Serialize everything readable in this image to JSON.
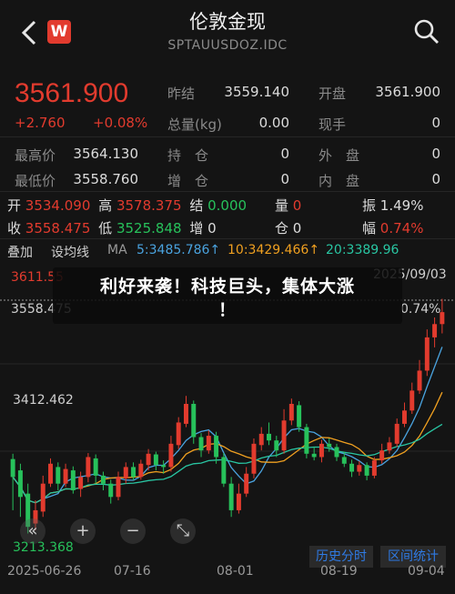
{
  "header": {
    "title": "伦敦金现",
    "code": "SPTAUUSDOZ.IDC",
    "badge": "W"
  },
  "quote": {
    "price": "3561.900",
    "change": "+2.760",
    "change_pct": "+0.08%",
    "stats": [
      {
        "label": "昨结",
        "value": "3559.140"
      },
      {
        "label": "开盘",
        "value": "3561.900"
      },
      {
        "label": "总量(kg)",
        "value": "0.00"
      },
      {
        "label": "现手",
        "value": "0"
      },
      {
        "label": "最高价",
        "value": "3564.130"
      },
      {
        "label": "持　仓",
        "value": "0"
      },
      {
        "label": "外　盘",
        "value": "0"
      },
      {
        "label": "最低价",
        "value": "3558.760"
      },
      {
        "label": "增　仓",
        "value": "0"
      },
      {
        "label": "内　盘",
        "value": "0"
      }
    ]
  },
  "kline_summary": {
    "open_label": "开",
    "open": "3534.090",
    "high_label": "高",
    "high": "3578.375",
    "settle_label": "结",
    "settle": "0.000",
    "volume_label": "量",
    "volume": "0",
    "amp_label": "振",
    "amp": "1.49%",
    "close_label": "收",
    "close": "3558.475",
    "low_label": "低",
    "low": "3525.848",
    "inc_label": "增",
    "inc": "0",
    "pos_label": "仓",
    "pos": "0",
    "range_label": "幅",
    "range": "0.74%"
  },
  "indicators": {
    "tab1": "叠加",
    "tab2": "设均线",
    "ma_label": "MA",
    "ma5": "5:3485.786↑",
    "ma10": "10:3429.466↑",
    "ma20": "20:3389.96"
  },
  "overlay": {
    "line1": "利好来袭！科技巨头，集体大涨",
    "line2": "！"
  },
  "chart_axis": {
    "top_price": "3611.55",
    "top_date": "2025/09/03",
    "cross_price": "3558.475",
    "cross_pct": "0.74%",
    "mid_price": "3412.462",
    "low_price": "3213.368",
    "x_labels": [
      "2025-06-26",
      "07-16",
      "08-01",
      "08-19",
      "09-04"
    ]
  },
  "controls": {
    "collapse": "«",
    "zoom_in": "+",
    "zoom_out": "−",
    "expand": "⤡"
  },
  "buttons": {
    "history": "历史分时",
    "stats": "区间统计"
  },
  "colors": {
    "up": "#e23b2e",
    "down": "#27c15b",
    "ma5": "#4aa3df",
    "ma10": "#f0a020",
    "ma20": "#29c6a3"
  },
  "chart_data": {
    "type": "candlestick",
    "ylim": [
      3213.368,
      3611.55
    ],
    "candles": [
      [
        3337,
        3310,
        3345,
        3260
      ],
      [
        3320,
        3280,
        3330,
        3250
      ],
      [
        3285,
        3235,
        3300,
        3225
      ],
      [
        3240,
        3260,
        3275,
        3230
      ],
      [
        3258,
        3300,
        3312,
        3250
      ],
      [
        3300,
        3330,
        3338,
        3295
      ],
      [
        3325,
        3300,
        3332,
        3290
      ],
      [
        3300,
        3322,
        3330,
        3295
      ],
      [
        3320,
        3290,
        3326,
        3285
      ],
      [
        3292,
        3310,
        3318,
        3280
      ],
      [
        3310,
        3340,
        3346,
        3302
      ],
      [
        3338,
        3312,
        3344,
        3300
      ],
      [
        3312,
        3300,
        3318,
        3290
      ],
      [
        3300,
        3280,
        3306,
        3270
      ],
      [
        3280,
        3310,
        3318,
        3275
      ],
      [
        3308,
        3325,
        3332,
        3300
      ],
      [
        3325,
        3310,
        3332,
        3305
      ],
      [
        3310,
        3330,
        3336,
        3306
      ],
      [
        3328,
        3345,
        3352,
        3320
      ],
      [
        3344,
        3328,
        3348,
        3320
      ],
      [
        3328,
        3325,
        3335,
        3315
      ],
      [
        3325,
        3360,
        3372,
        3318
      ],
      [
        3358,
        3392,
        3400,
        3352
      ],
      [
        3390,
        3420,
        3432,
        3385
      ],
      [
        3420,
        3370,
        3425,
        3360
      ],
      [
        3370,
        3350,
        3376,
        3340
      ],
      [
        3350,
        3372,
        3380,
        3345
      ],
      [
        3372,
        3340,
        3378,
        3330
      ],
      [
        3340,
        3300,
        3346,
        3295
      ],
      [
        3300,
        3260,
        3310,
        3250
      ],
      [
        3260,
        3285,
        3300,
        3255
      ],
      [
        3285,
        3315,
        3325,
        3280
      ],
      [
        3315,
        3360,
        3368,
        3308
      ],
      [
        3358,
        3375,
        3385,
        3350
      ],
      [
        3375,
        3365,
        3392,
        3358
      ],
      [
        3365,
        3350,
        3372,
        3340
      ],
      [
        3350,
        3395,
        3412,
        3345
      ],
      [
        3395,
        3420,
        3428,
        3388
      ],
      [
        3418,
        3385,
        3424,
        3378
      ],
      [
        3385,
        3345,
        3390,
        3338
      ],
      [
        3345,
        3340,
        3355,
        3335
      ],
      [
        3340,
        3360,
        3366,
        3332
      ],
      [
        3360,
        3355,
        3368,
        3348
      ],
      [
        3355,
        3340,
        3360,
        3334
      ],
      [
        3340,
        3330,
        3348,
        3325
      ],
      [
        3330,
        3318,
        3336,
        3310
      ],
      [
        3318,
        3328,
        3334,
        3312
      ],
      [
        3328,
        3312,
        3332,
        3305
      ],
      [
        3312,
        3335,
        3340,
        3308
      ],
      [
        3335,
        3350,
        3360,
        3330
      ],
      [
        3350,
        3362,
        3370,
        3345
      ],
      [
        3360,
        3390,
        3398,
        3355
      ],
      [
        3390,
        3410,
        3422,
        3385
      ],
      [
        3410,
        3440,
        3452,
        3405
      ],
      [
        3440,
        3470,
        3486,
        3435
      ],
      [
        3470,
        3520,
        3532,
        3462
      ],
      [
        3520,
        3540,
        3550,
        3505
      ],
      [
        3540,
        3558,
        3578,
        3526
      ]
    ],
    "ma5_label": "5:3485.786↑",
    "ma10_label": "10:3429.466↑",
    "ma20_label": "20:3389.96"
  }
}
